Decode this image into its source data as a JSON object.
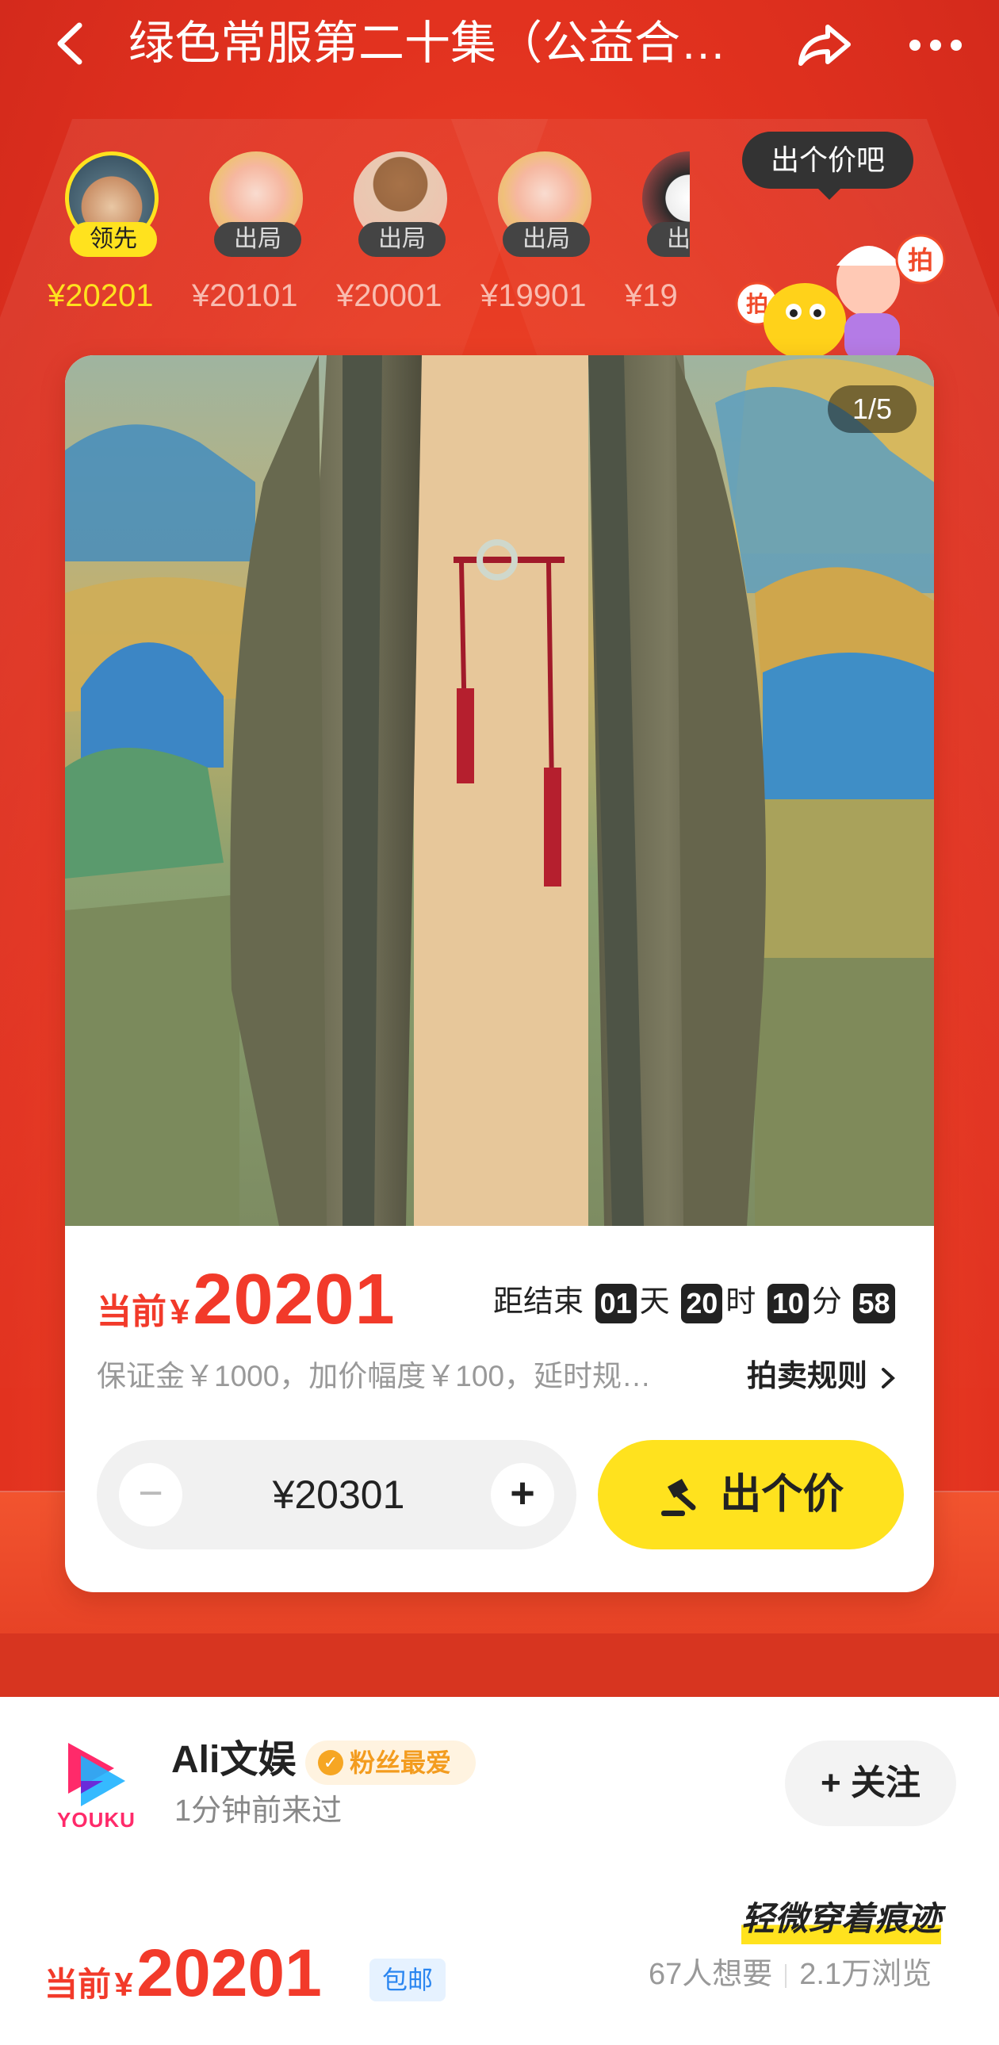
{
  "header": {
    "title": "绿色常服第二十集（公益合…",
    "back_icon": "back-icon",
    "share_icon": "share-icon",
    "more_icon": "more-icon"
  },
  "bidders": [
    {
      "badge": "领先",
      "price": "¥20201",
      "leading": true
    },
    {
      "badge": "出局",
      "price": "¥20101",
      "leading": false
    },
    {
      "badge": "出局",
      "price": "¥20001",
      "leading": false
    },
    {
      "badge": "出局",
      "price": "¥19901",
      "leading": false
    },
    {
      "badge": "出局",
      "price": "¥19",
      "leading": false
    }
  ],
  "tip": "出个价吧",
  "gallery": {
    "counter": "1/5"
  },
  "auction": {
    "current_label": "当前",
    "currency": "¥",
    "current_price": "20201",
    "countdown_label": "距结束",
    "days": "01",
    "days_unit": "天",
    "hours": "20",
    "hours_unit": "时",
    "minutes": "10",
    "minutes_unit": "分",
    "seconds": "58",
    "rules_text": "保证金￥1000，加价幅度￥100，延时规…",
    "rules_link": "拍卖规则",
    "minus": "−",
    "plus": "+",
    "bid_value": "¥20301",
    "bid_button": "出个价"
  },
  "seller": {
    "logo_text": "YOUKU",
    "name": "Ali文娱",
    "badge": "粉丝最爱",
    "visited": "1分钟前来过",
    "follow": "关注"
  },
  "listing": {
    "condition": "轻微穿着痕迹",
    "current_label": "当前",
    "currency": "¥",
    "price": "20201",
    "shipping": "包邮",
    "wants": "67人想要",
    "views": "2.1万浏览"
  },
  "colors": {
    "accent": "#f23a2a",
    "bid_yellow": "#ffe21e",
    "bg_red": "#e2321f"
  }
}
